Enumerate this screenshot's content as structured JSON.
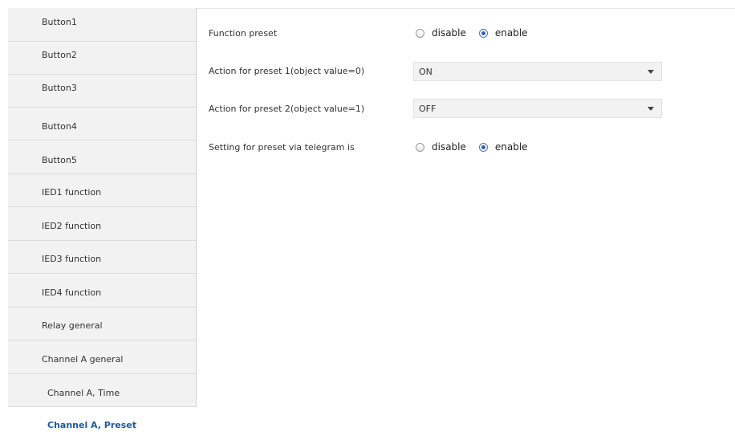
{
  "sidebar": {
    "items": [
      {
        "label": "Button1",
        "active": false
      },
      {
        "label": "Button2",
        "active": false
      },
      {
        "label": "Button3",
        "active": false
      },
      {
        "label": "Button4",
        "active": false
      },
      {
        "label": "Button5",
        "active": false
      },
      {
        "label": "IED1 function",
        "active": false
      },
      {
        "label": "IED2 function",
        "active": false
      },
      {
        "label": "IED3 function",
        "active": false
      },
      {
        "label": "IED4 function",
        "active": false
      },
      {
        "label": "Relay general",
        "active": false
      },
      {
        "label": "Channel A general",
        "active": false
      },
      {
        "label": "Channel A, Time",
        "active": false
      },
      {
        "label": "Channel A, Preset",
        "active": true
      }
    ]
  },
  "params": {
    "function_preset": {
      "label": "Function preset",
      "options": [
        "disable",
        "enable"
      ],
      "selected": "enable"
    },
    "action_preset1": {
      "label": "Action for preset 1(object value=0)",
      "value": "ON"
    },
    "action_preset2": {
      "label": "Action for preset 2(object value=1)",
      "value": "OFF"
    },
    "setting_via_telegram": {
      "label": "Setting for preset via telegram is",
      "options": [
        "disable",
        "enable"
      ],
      "selected": "enable"
    }
  },
  "colors": {
    "active_nav_text": "#1e5aa0",
    "nav_background": "#f2f2f2",
    "radio_checked": "#2c5fb5"
  }
}
